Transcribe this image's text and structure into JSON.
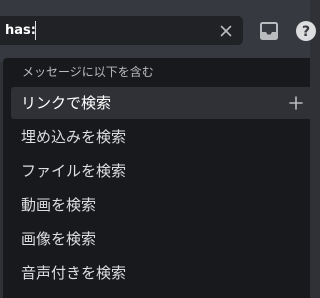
{
  "search": {
    "query": "has:",
    "clear_icon": "close-icon"
  },
  "toolbar": {
    "inbox_icon": "inbox-icon",
    "help_icon": "help-icon",
    "help_glyph": "?"
  },
  "popout": {
    "header": "メッセージに以下を含む",
    "options": [
      {
        "label": "リンクで検索",
        "active": true,
        "icon": "plus-icon"
      },
      {
        "label": "埋め込みを検索"
      },
      {
        "label": "ファイルを検索"
      },
      {
        "label": "動画を検索"
      },
      {
        "label": "画像を検索"
      },
      {
        "label": "音声付きを検索"
      }
    ]
  },
  "colors": {
    "topbar_bg": "#36393f",
    "search_bg": "#202225",
    "popout_bg": "#18191c",
    "active_option_bg": "#2f3136",
    "text_primary": "#dcddde",
    "text_header": "#b9bbbe"
  }
}
